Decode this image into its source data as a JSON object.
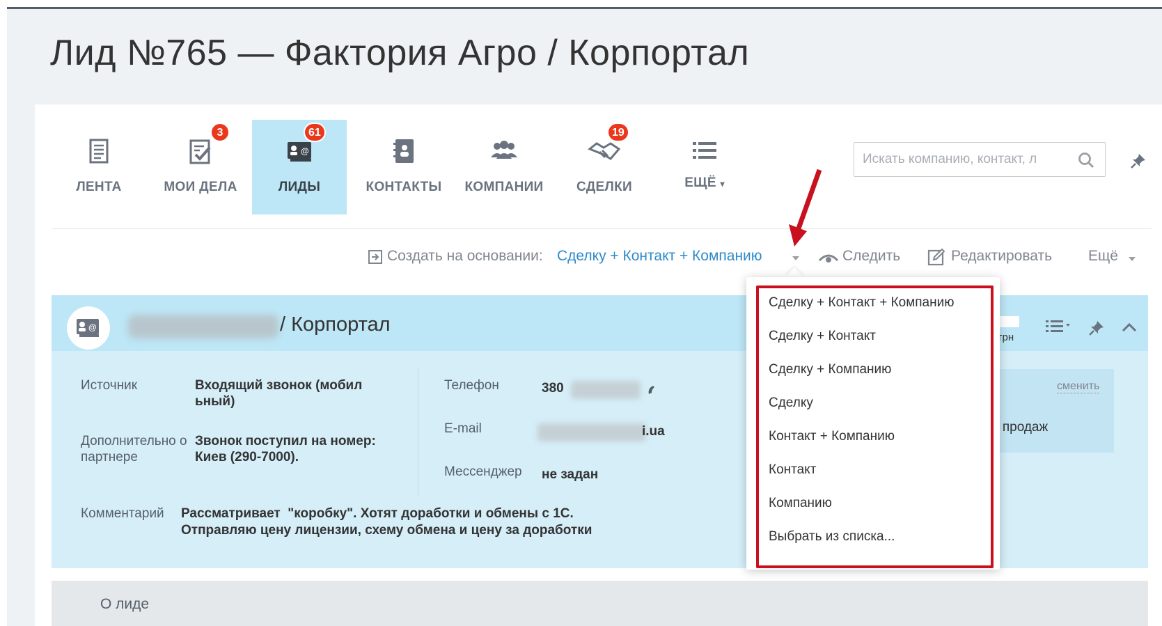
{
  "page_title": "Лид №765 — Фактория Агро / Корпортал",
  "nav": {
    "tiles": [
      {
        "label": "ЛЕНТА",
        "icon": "feed-icon",
        "badge": ""
      },
      {
        "label": "МОИ ДЕЛА",
        "icon": "tasks-icon",
        "badge": "3"
      },
      {
        "label": "ЛИДЫ",
        "icon": "leads-icon",
        "badge": "61",
        "active": true
      },
      {
        "label": "КОНТАКТЫ",
        "icon": "contacts-icon",
        "badge": ""
      },
      {
        "label": "КОМПАНИИ",
        "icon": "companies-icon",
        "badge": ""
      },
      {
        "label": "СДЕЛКИ",
        "icon": "deals-icon",
        "badge": "19"
      },
      {
        "label": "ЕЩЁ",
        "icon": "more-list-icon",
        "badge": "",
        "has_caret": true
      }
    ],
    "search_placeholder": "Искать компанию, контакт, л"
  },
  "actions": {
    "create_label": "Создать на основании:",
    "create_link": "Сделку + Контакт + Компанию",
    "follow_label": "Следить",
    "edit_label": "Редактировать",
    "more_label": "Ещё"
  },
  "lead": {
    "title_suffix": "/ Корпортал",
    "currency": "грн",
    "fields": {
      "source_label": "Источник",
      "source_value": "Входящий звонок (мобил ьный)",
      "extra_label": "Дополнительно о партнере",
      "extra_value": "Звонок поступил на номер: Киев (290-7000).",
      "phone_label": "Телефон",
      "phone_value": "380",
      "email_label": "E-mail",
      "email_value": "i.ua",
      "messenger_label": "Мессенджер",
      "messenger_value": "не задан",
      "comment_label": "Комментарий",
      "comment_line1": "Рассматривает  \"коробку\". Хотят доработки и обмены с 1С.",
      "comment_line2": "Отправляю цену лицензии, схему обмена и цену за доработки"
    },
    "responsible": {
      "change_link": "сменить",
      "line1_partial": "о",
      "line2_partial": "а продаж"
    }
  },
  "about_label": "О лиде",
  "dropdown": {
    "items": [
      "Сделку + Контакт + Компанию",
      "Сделку + Контакт",
      "Сделку + Компанию",
      "Сделку",
      "Контакт + Компанию",
      "Контакт",
      "Компанию",
      "Выбрать из списка..."
    ]
  },
  "colors": {
    "accent_link": "#2e8bc9",
    "active_tile": "#bde6f6",
    "badge": "#e9381c",
    "highlight_frame": "#c8101e"
  }
}
